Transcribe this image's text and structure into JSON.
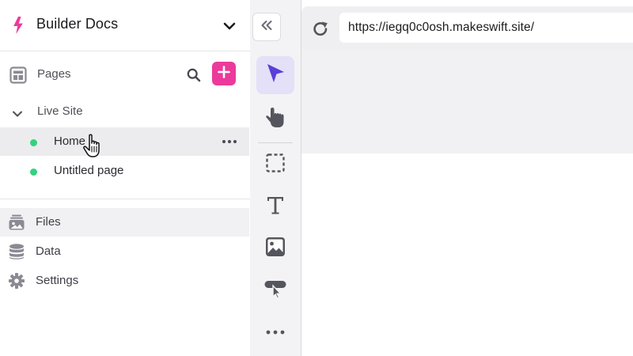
{
  "brand": {
    "title": "Builder Docs"
  },
  "pages_section": {
    "label": "Pages"
  },
  "live_site": {
    "label": "Live Site",
    "pages": [
      {
        "label": "Home"
      },
      {
        "label": "Untitled page"
      }
    ]
  },
  "nav": {
    "items": [
      {
        "label": "Files",
        "icon": "files-icon"
      },
      {
        "label": "Data",
        "icon": "database-icon"
      },
      {
        "label": "Settings",
        "icon": "gear-icon"
      }
    ]
  },
  "tools": [
    "select",
    "hand",
    "box",
    "text",
    "image",
    "button",
    "more"
  ],
  "browser": {
    "url": "https://iegq0c0osh.makeswift.site/"
  },
  "colors": {
    "accent": "#ec3a9b",
    "active_tool": "#5b3fd6",
    "status_dot": "#34d27f"
  }
}
